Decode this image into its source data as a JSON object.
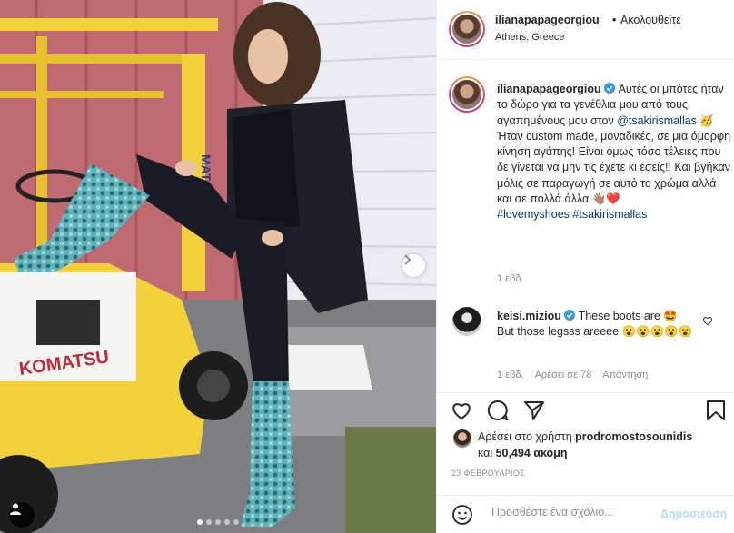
{
  "post": {
    "username": "ilianapapageorgiou",
    "dot": "•",
    "follow_label": "Ακολουθείτε",
    "location": "Athens, Greece",
    "photo_logo": "KOMATSU",
    "photo_mast_text": "MATSU",
    "carousel_dots": 5,
    "carousel_active": 1
  },
  "caption": {
    "username": "ilianapapageorgiou",
    "verified_icon": "verified-badge",
    "text_part1": "Αυτές οι μπότες ήταν το δώρο για τα γενέθλια μου από τους αγαπημένους μου στον",
    "mention": "@tsakirismallas",
    "emoji1": "🥳",
    "text_part2": "Ήταν custom made, μοναδικές, σε μια όμορφη κίνηση αγάπης! Είναι όμως τόσο τέλειες που δε γίνεται να μην τις έχετε κι εσείς!! Και βγήκαν μόλις σε παραγωγή σε αυτό το χρώμα αλλά και σε πολλά άλλα",
    "emoji2": "👋🏽❤️",
    "hashtag1": "#lovemyshoes",
    "hashtag2": "#tsakirismallas",
    "time": "1 εβδ."
  },
  "comment": {
    "username": "keisi.miziou",
    "text_part1": "These boots are",
    "emoji1": "🤩",
    "text_part2": "But those legsss areeee",
    "emoji2": "😮😮😮😮😮",
    "time": "1 εβδ.",
    "likes": "Αρέσει σε 78",
    "reply_label": "Απάντηση"
  },
  "likes": {
    "prefix": "Αρέσει στο χρήστη",
    "user": "prodromostosounidis",
    "and_label": "και",
    "count": "50,494",
    "suffix": "ακόμη"
  },
  "date": "23 ΦΕΒΡΟΥΑΡΙΟΣ",
  "add_comment": {
    "placeholder": "Προσθέστε ένα σχόλιο...",
    "post_label": "Δημοσίευση"
  },
  "colors": {
    "link": "#00376b",
    "post_button": "#b3dbff",
    "verified": "#3897f0",
    "forklift": "#f2d13a"
  }
}
